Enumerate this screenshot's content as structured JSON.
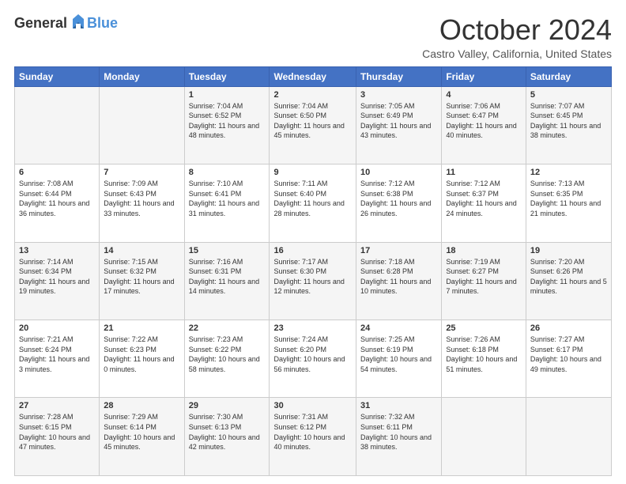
{
  "logo": {
    "general": "General",
    "blue": "Blue"
  },
  "header": {
    "month": "October 2024",
    "location": "Castro Valley, California, United States"
  },
  "days_of_week": [
    "Sunday",
    "Monday",
    "Tuesday",
    "Wednesday",
    "Thursday",
    "Friday",
    "Saturday"
  ],
  "weeks": [
    [
      {
        "day": "",
        "sunrise": "",
        "sunset": "",
        "daylight": ""
      },
      {
        "day": "",
        "sunrise": "",
        "sunset": "",
        "daylight": ""
      },
      {
        "day": "1",
        "sunrise": "Sunrise: 7:04 AM",
        "sunset": "Sunset: 6:52 PM",
        "daylight": "Daylight: 11 hours and 48 minutes."
      },
      {
        "day": "2",
        "sunrise": "Sunrise: 7:04 AM",
        "sunset": "Sunset: 6:50 PM",
        "daylight": "Daylight: 11 hours and 45 minutes."
      },
      {
        "day": "3",
        "sunrise": "Sunrise: 7:05 AM",
        "sunset": "Sunset: 6:49 PM",
        "daylight": "Daylight: 11 hours and 43 minutes."
      },
      {
        "day": "4",
        "sunrise": "Sunrise: 7:06 AM",
        "sunset": "Sunset: 6:47 PM",
        "daylight": "Daylight: 11 hours and 40 minutes."
      },
      {
        "day": "5",
        "sunrise": "Sunrise: 7:07 AM",
        "sunset": "Sunset: 6:45 PM",
        "daylight": "Daylight: 11 hours and 38 minutes."
      }
    ],
    [
      {
        "day": "6",
        "sunrise": "Sunrise: 7:08 AM",
        "sunset": "Sunset: 6:44 PM",
        "daylight": "Daylight: 11 hours and 36 minutes."
      },
      {
        "day": "7",
        "sunrise": "Sunrise: 7:09 AM",
        "sunset": "Sunset: 6:43 PM",
        "daylight": "Daylight: 11 hours and 33 minutes."
      },
      {
        "day": "8",
        "sunrise": "Sunrise: 7:10 AM",
        "sunset": "Sunset: 6:41 PM",
        "daylight": "Daylight: 11 hours and 31 minutes."
      },
      {
        "day": "9",
        "sunrise": "Sunrise: 7:11 AM",
        "sunset": "Sunset: 6:40 PM",
        "daylight": "Daylight: 11 hours and 28 minutes."
      },
      {
        "day": "10",
        "sunrise": "Sunrise: 7:12 AM",
        "sunset": "Sunset: 6:38 PM",
        "daylight": "Daylight: 11 hours and 26 minutes."
      },
      {
        "day": "11",
        "sunrise": "Sunrise: 7:12 AM",
        "sunset": "Sunset: 6:37 PM",
        "daylight": "Daylight: 11 hours and 24 minutes."
      },
      {
        "day": "12",
        "sunrise": "Sunrise: 7:13 AM",
        "sunset": "Sunset: 6:35 PM",
        "daylight": "Daylight: 11 hours and 21 minutes."
      }
    ],
    [
      {
        "day": "13",
        "sunrise": "Sunrise: 7:14 AM",
        "sunset": "Sunset: 6:34 PM",
        "daylight": "Daylight: 11 hours and 19 minutes."
      },
      {
        "day": "14",
        "sunrise": "Sunrise: 7:15 AM",
        "sunset": "Sunset: 6:32 PM",
        "daylight": "Daylight: 11 hours and 17 minutes."
      },
      {
        "day": "15",
        "sunrise": "Sunrise: 7:16 AM",
        "sunset": "Sunset: 6:31 PM",
        "daylight": "Daylight: 11 hours and 14 minutes."
      },
      {
        "day": "16",
        "sunrise": "Sunrise: 7:17 AM",
        "sunset": "Sunset: 6:30 PM",
        "daylight": "Daylight: 11 hours and 12 minutes."
      },
      {
        "day": "17",
        "sunrise": "Sunrise: 7:18 AM",
        "sunset": "Sunset: 6:28 PM",
        "daylight": "Daylight: 11 hours and 10 minutes."
      },
      {
        "day": "18",
        "sunrise": "Sunrise: 7:19 AM",
        "sunset": "Sunset: 6:27 PM",
        "daylight": "Daylight: 11 hours and 7 minutes."
      },
      {
        "day": "19",
        "sunrise": "Sunrise: 7:20 AM",
        "sunset": "Sunset: 6:26 PM",
        "daylight": "Daylight: 11 hours and 5 minutes."
      }
    ],
    [
      {
        "day": "20",
        "sunrise": "Sunrise: 7:21 AM",
        "sunset": "Sunset: 6:24 PM",
        "daylight": "Daylight: 11 hours and 3 minutes."
      },
      {
        "day": "21",
        "sunrise": "Sunrise: 7:22 AM",
        "sunset": "Sunset: 6:23 PM",
        "daylight": "Daylight: 11 hours and 0 minutes."
      },
      {
        "day": "22",
        "sunrise": "Sunrise: 7:23 AM",
        "sunset": "Sunset: 6:22 PM",
        "daylight": "Daylight: 10 hours and 58 minutes."
      },
      {
        "day": "23",
        "sunrise": "Sunrise: 7:24 AM",
        "sunset": "Sunset: 6:20 PM",
        "daylight": "Daylight: 10 hours and 56 minutes."
      },
      {
        "day": "24",
        "sunrise": "Sunrise: 7:25 AM",
        "sunset": "Sunset: 6:19 PM",
        "daylight": "Daylight: 10 hours and 54 minutes."
      },
      {
        "day": "25",
        "sunrise": "Sunrise: 7:26 AM",
        "sunset": "Sunset: 6:18 PM",
        "daylight": "Daylight: 10 hours and 51 minutes."
      },
      {
        "day": "26",
        "sunrise": "Sunrise: 7:27 AM",
        "sunset": "Sunset: 6:17 PM",
        "daylight": "Daylight: 10 hours and 49 minutes."
      }
    ],
    [
      {
        "day": "27",
        "sunrise": "Sunrise: 7:28 AM",
        "sunset": "Sunset: 6:15 PM",
        "daylight": "Daylight: 10 hours and 47 minutes."
      },
      {
        "day": "28",
        "sunrise": "Sunrise: 7:29 AM",
        "sunset": "Sunset: 6:14 PM",
        "daylight": "Daylight: 10 hours and 45 minutes."
      },
      {
        "day": "29",
        "sunrise": "Sunrise: 7:30 AM",
        "sunset": "Sunset: 6:13 PM",
        "daylight": "Daylight: 10 hours and 42 minutes."
      },
      {
        "day": "30",
        "sunrise": "Sunrise: 7:31 AM",
        "sunset": "Sunset: 6:12 PM",
        "daylight": "Daylight: 10 hours and 40 minutes."
      },
      {
        "day": "31",
        "sunrise": "Sunrise: 7:32 AM",
        "sunset": "Sunset: 6:11 PM",
        "daylight": "Daylight: 10 hours and 38 minutes."
      },
      {
        "day": "",
        "sunrise": "",
        "sunset": "",
        "daylight": ""
      },
      {
        "day": "",
        "sunrise": "",
        "sunset": "",
        "daylight": ""
      }
    ]
  ]
}
